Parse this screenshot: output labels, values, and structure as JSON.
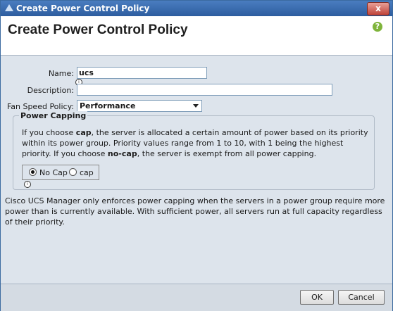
{
  "window": {
    "title": "Create Power Control Policy",
    "close_glyph": "x"
  },
  "header": {
    "title": "Create Power Control Policy",
    "help_glyph": "?"
  },
  "form": {
    "name_label": "Name:",
    "name_value": "ucs",
    "description_label": "Description:",
    "description_value": "",
    "fan_label": "Fan Speed Policy:",
    "fan_value": "Performance",
    "info_glyph": "i"
  },
  "power_capping": {
    "legend": "Power Capping",
    "text_1": "If you choose ",
    "text_cap": "cap",
    "text_2": ", the server is allocated a certain amount of power based on its priority within its power group. Priority values range from 1 to 10, with 1 being the highest priority. If you choose ",
    "text_nocap": "no-cap",
    "text_3": ", the server is exempt from all power capping.",
    "options": [
      "No Cap",
      "cap"
    ],
    "selected": "No Cap"
  },
  "note": "Cisco UCS Manager only enforces power capping when the servers in a power group require more power than is currently available. With sufficient power, all servers run at full capacity regardless of their priority.",
  "footer": {
    "ok_label": "OK",
    "cancel_label": "Cancel"
  }
}
